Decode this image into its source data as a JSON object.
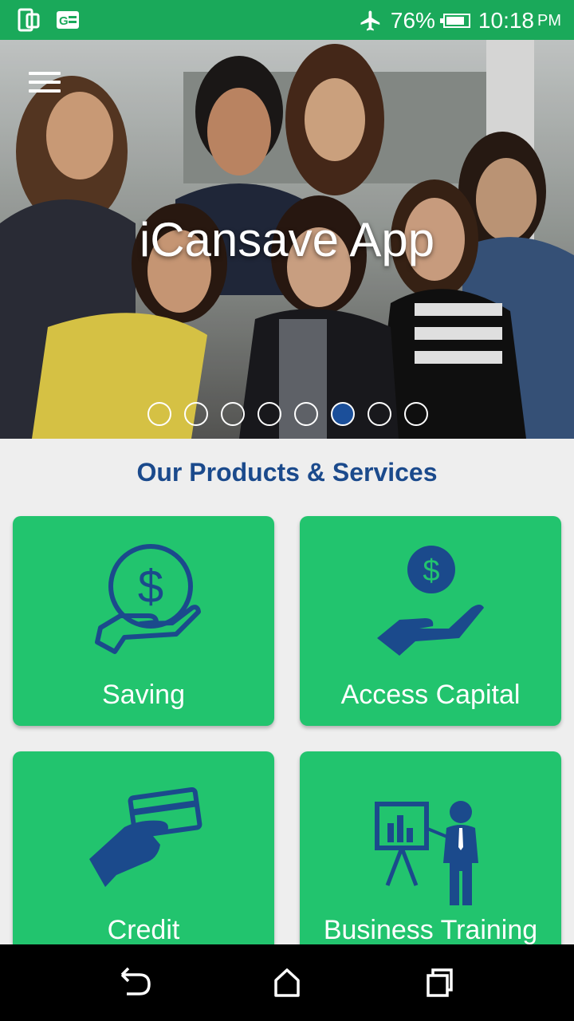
{
  "status_bar": {
    "battery": "76%",
    "time": "10:18",
    "ampm": "PM",
    "icons": [
      "phone-icon",
      "sim-card-icon",
      "airplane-mode-icon",
      "battery-icon"
    ]
  },
  "hero": {
    "title": "iCansave App",
    "carousel": {
      "total": 8,
      "active_index": 5
    }
  },
  "products": {
    "heading": "Our Products & Services",
    "items": [
      {
        "label": "Saving",
        "icon": "hand-coin-icon"
      },
      {
        "label": "Access Capital",
        "icon": "hand-receiving-coin-icon"
      },
      {
        "label": "Credit",
        "icon": "hand-card-icon"
      },
      {
        "label": "Business Training",
        "icon": "presentation-icon"
      }
    ]
  },
  "colors": {
    "status_bar": "#1aa95a",
    "card": "#22c46e",
    "accent": "#1b4a8c"
  }
}
